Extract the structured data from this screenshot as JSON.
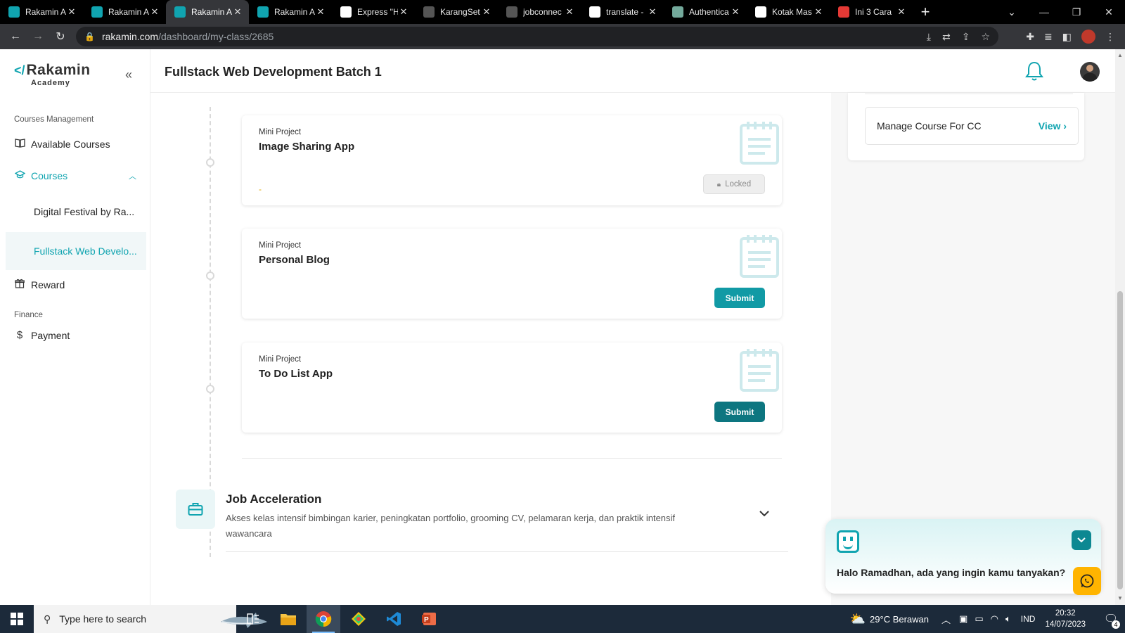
{
  "browser": {
    "tabs": [
      {
        "title": "Rakamin A",
        "favicon": "rakamin-icon",
        "color": "#10a4b0",
        "active": false
      },
      {
        "title": "Rakamin A",
        "favicon": "rakamin-icon",
        "color": "#10a4b0",
        "active": false
      },
      {
        "title": "Rakamin A",
        "favicon": "rakamin-icon",
        "color": "#10a4b0",
        "active": true
      },
      {
        "title": "Rakamin A",
        "favicon": "rakamin-icon",
        "color": "#10a4b0",
        "active": false
      },
      {
        "title": "Express \"H",
        "favicon": "express-icon",
        "color": "#ffffff",
        "active": false
      },
      {
        "title": "KarangSet",
        "favicon": "github-icon",
        "color": "#555555",
        "active": false
      },
      {
        "title": "jobconnec",
        "favicon": "github-icon",
        "color": "#555555",
        "active": false
      },
      {
        "title": "translate -",
        "favicon": "google-icon",
        "color": "#ffffff",
        "active": false
      },
      {
        "title": "Authentica",
        "favicon": "chatgpt-icon",
        "color": "#74aa9c",
        "active": false
      },
      {
        "title": "Kotak Mas",
        "favicon": "gmail-icon",
        "color": "#ffffff",
        "active": false
      },
      {
        "title": "Ini 3 Cara",
        "favicon": "magnet-icon",
        "color": "#e53935",
        "active": false
      }
    ],
    "url_host": "rakamin.com",
    "url_path": "/dashboard/my-class/2685"
  },
  "sidebar": {
    "logo_name": "Rakamin",
    "logo_sub": "Academy",
    "section_courses_mgmt": "Courses Management",
    "available_courses": "Available Courses",
    "courses": "Courses",
    "course_1": "Digital Festival by Ra...",
    "course_2": "Fullstack Web Develo...",
    "reward": "Reward",
    "section_finance": "Finance",
    "payment": "Payment"
  },
  "header": {
    "title": "Fullstack Web Development Batch 1"
  },
  "projects": [
    {
      "kind": "Mini Project",
      "title": "Image Sharing App",
      "status": "locked",
      "button": "Locked",
      "note": "-"
    },
    {
      "kind": "Mini Project",
      "title": "Personal Blog",
      "status": "submit",
      "button": "Submit"
    },
    {
      "kind": "Mini Project",
      "title": "To Do List App",
      "status": "submit",
      "button": "Submit"
    }
  ],
  "job_acceleration": {
    "title": "Job Acceleration",
    "description": "Akses kelas intensif bimbingan karier, peningkatan portfolio, grooming CV, pelamaran kerja, dan praktik intensif wawancara"
  },
  "right_panel": {
    "manage_label": "Manage Course For CC",
    "view_label": "View"
  },
  "chat": {
    "message": "Halo Ramadhan, ada yang ingin kamu tanyakan?"
  },
  "taskbar": {
    "search_placeholder": "Type here to search",
    "weather": "29°C  Berawan",
    "lang": "IND",
    "time": "20:32",
    "date": "14/07/2023",
    "notif_count": "4"
  },
  "colors": {
    "brand": "#10a4b0",
    "submit_dark": "#0d7680",
    "whatsapp_button": "#ffb400"
  }
}
